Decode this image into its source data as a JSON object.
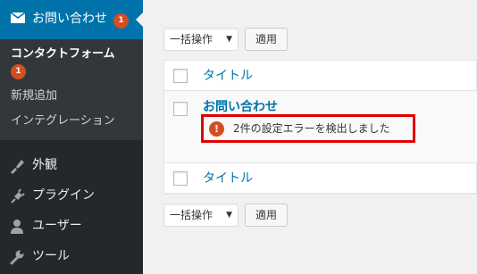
{
  "sidebar": {
    "current_menu": {
      "label": "お問い合わせ",
      "badge": "1",
      "icon": "mail-icon"
    },
    "submenu": {
      "current_label": "コンタクトフォーム",
      "current_badge": "1",
      "items": [
        "新規追加",
        "インテグレーション"
      ]
    },
    "items": [
      {
        "label": "外観",
        "icon": "paintbrush-icon"
      },
      {
        "label": "プラグイン",
        "icon": "plugin-icon"
      },
      {
        "label": "ユーザー",
        "icon": "user-icon"
      },
      {
        "label": "ツール",
        "icon": "wrench-icon"
      }
    ],
    "colors": {
      "bg": "#23282d",
      "submenu_bg": "#32373c",
      "accent": "#0073aa",
      "badge": "#d54e21"
    }
  },
  "toolbar": {
    "bulk_label": "一括操作",
    "apply_label": "適用"
  },
  "table": {
    "header_title": "タイトル",
    "footer_title": "タイトル",
    "rows": [
      {
        "title": "お問い合わせ",
        "error_icon": "exclamation-icon",
        "error_text": "2件の設定エラーを検出しました"
      }
    ]
  }
}
